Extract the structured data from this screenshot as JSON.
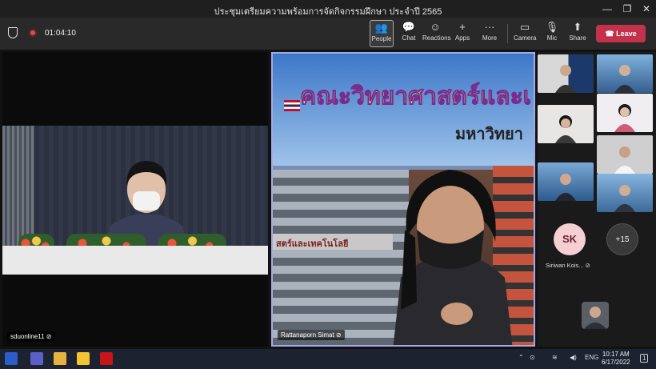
{
  "window": {
    "title": "ประชุมเตรียมความพร้อมการจัดกิจกรรมฝึกษา ประจำปี 2565",
    "minimize": "—",
    "restore": "❐",
    "close": "✕"
  },
  "toolbar": {
    "timer": "01:04:10",
    "buttons": [
      {
        "label": "People",
        "icon": "people-icon",
        "glyph": "👥"
      },
      {
        "label": "Chat",
        "icon": "chat-icon",
        "glyph": "💬"
      },
      {
        "label": "Reactions",
        "icon": "reactions-icon",
        "glyph": "☺"
      },
      {
        "label": "Apps",
        "icon": "apps-icon",
        "glyph": "+"
      },
      {
        "label": "More",
        "icon": "more-icon",
        "glyph": "···"
      },
      {
        "label": "Camera",
        "icon": "camera-off-icon",
        "glyph": "▭"
      },
      {
        "label": "Mic",
        "icon": "mic-off-icon",
        "glyph": "🎙"
      },
      {
        "label": "Share",
        "icon": "share-icon",
        "glyph": "⬆"
      }
    ],
    "leave_label": "Leave",
    "leave_icon": "phone-hangup-icon"
  },
  "stage": {
    "left_tile_name": "sduonline11",
    "center_tile_name": "Rattanaporn Simat",
    "banner_line1": "คณะวิทยาศาสตร์และเ",
    "banner_line2": "มหาวิทยา",
    "building_sign": "สตร์และเทคโนโลยี"
  },
  "participants": {
    "sk_initials": "SK",
    "sk_name": "Siriwan Kois...",
    "overflow_count": "+15"
  },
  "taskbar": {
    "language": "ENG",
    "time": "10:17 AM",
    "date": "6/17/2022",
    "notification_count": "1"
  },
  "colors": {
    "leave": "#c4314b",
    "speaker_border": "#a7a8e6",
    "avatar_bg": "#f5cfd2",
    "record": "#e4474f"
  }
}
